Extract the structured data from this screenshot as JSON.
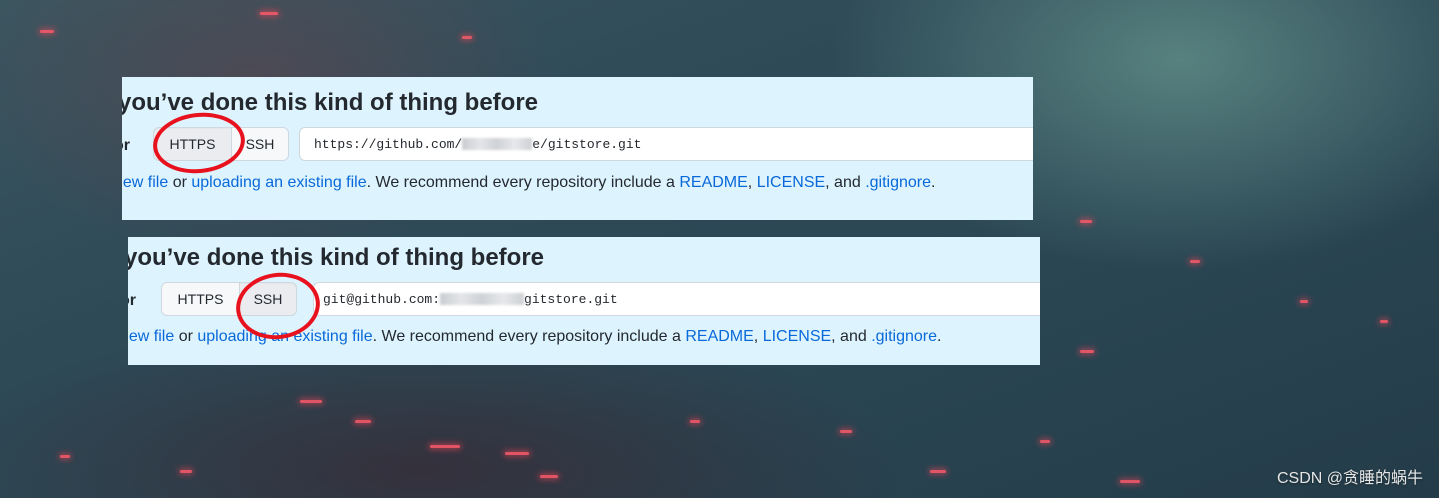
{
  "panel_top": {
    "heading": "you’ve done this kind of thing before",
    "or_label": "or",
    "protocol_buttons": {
      "https_label": "HTTPS",
      "ssh_label": "SSH",
      "selected": "HTTPS"
    },
    "clone_url_prefix": "https://github.com/",
    "clone_url_suffix": "e/gitstore.git",
    "helper": {
      "new_file_link": "new file",
      "text_or": " or ",
      "upload_link": "uploading an existing file",
      "text_recommend": ". We recommend every repository include a ",
      "readme_link": "README",
      "comma": ", ",
      "license_link": "LICENSE",
      "text_and": ", and ",
      "gitignore_link": ".gitignore",
      "period": "."
    }
  },
  "panel_bottom": {
    "heading": "you’ve done this kind of thing before",
    "or_label": "or",
    "protocol_buttons": {
      "https_label": "HTTPS",
      "ssh_label": "SSH",
      "selected": "SSH"
    },
    "clone_url_prefix": "git@github.com:",
    "clone_url_suffix": "gitstore.git",
    "helper": {
      "new_file_link": "new file",
      "text_or": " or ",
      "upload_link": "uploading an existing file",
      "text_recommend": ". We recommend every repository include a ",
      "readme_link": "README",
      "comma": ", ",
      "license_link": "LICENSE",
      "text_and": ", and ",
      "gitignore_link": ".gitignore",
      "period": "."
    }
  },
  "annotations": {
    "circle_color": "#e8121f"
  },
  "watermark": "CSDN @贪睡的蜗牛"
}
